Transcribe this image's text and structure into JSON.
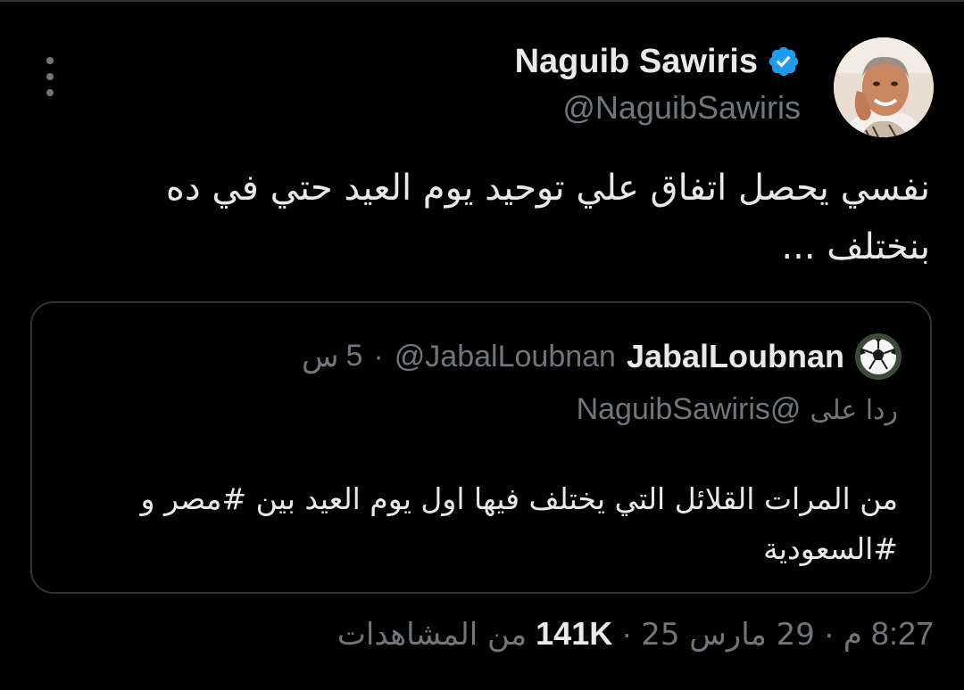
{
  "colors": {
    "background": "#000000",
    "primary_text": "#e7e9ea",
    "secondary_text": "#71767b",
    "border": "#2f3336",
    "verified_blue": "#1d9bf0"
  },
  "header": {
    "author_name": "Naguib Sawiris",
    "author_handle": "@NaguibSawiris",
    "verified_icon": "verified-badge-icon",
    "avatar_icon": "profile-photo",
    "more_icon": "vertical-dots-icon"
  },
  "tweet": {
    "text_line1": "نفسي يحصل اتفاق علي توحيد يوم العيد حتي في ده",
    "text_line2": "بنختلف ..."
  },
  "quote": {
    "avatar_icon": "soccer-ball-avatar",
    "name": "JabalLoubnan",
    "handle": "@JabalLoubnan",
    "separator": "·",
    "time_value": "5",
    "time_unit": "س",
    "reply_label": "ردا على",
    "reply_handle": "@NaguibSawiris",
    "text_line1": "من المرات القلائل التي يختلف فيها اول يوم العيد بين #مصر و",
    "text_line2": "#السعودية"
  },
  "meta": {
    "time": "8:27",
    "period": "م",
    "date": "29 مارس 25",
    "separator": "·",
    "views_count": "141K",
    "views_label": "من المشاهدات"
  }
}
